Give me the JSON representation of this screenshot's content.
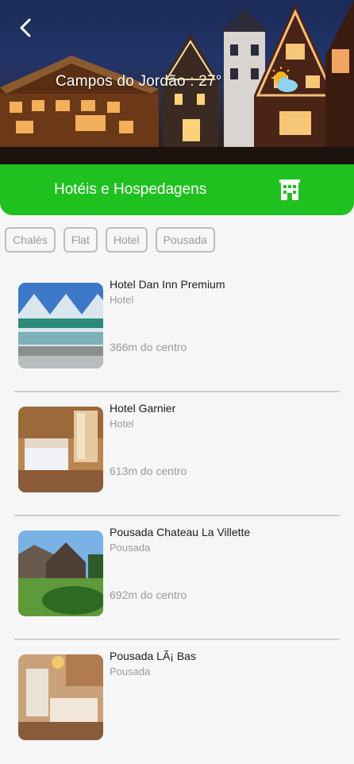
{
  "header": {
    "city_weather": "Campos do Jordão : 27°",
    "weather_icon": "sun-cloud-icon",
    "back_icon": "back-chevron-icon"
  },
  "banner": {
    "title": "Hotéis e Hospedagens",
    "icon": "building-icon",
    "color": "#1fc11f"
  },
  "filters": [
    "Chalés",
    "Flat",
    "Hotel",
    "Pousada"
  ],
  "listings": [
    {
      "name": "Hotel Dan Inn Premium",
      "type": "Hotel",
      "distance": "366m do centro"
    },
    {
      "name": "Hotel Garnier",
      "type": "Hotel",
      "distance": "613m do centro"
    },
    {
      "name": "Pousada Chateau La Villette",
      "type": "Pousada",
      "distance": "692m do centro"
    },
    {
      "name": "Pousada LÃ¡ Bas",
      "type": "Pousada",
      "distance": ""
    }
  ]
}
